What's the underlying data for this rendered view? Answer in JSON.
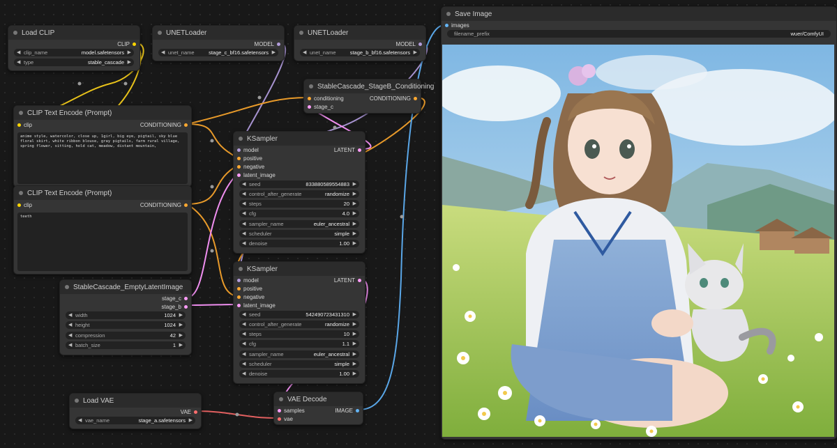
{
  "colors": {
    "clip": "#ffd500",
    "model": "#b39ddb",
    "conditioning": "#ffa931",
    "latent": "#ff9cf9",
    "vae": "#ff6e6e",
    "image": "#64b5f6"
  },
  "load_clip": {
    "title": "Load CLIP",
    "output": "CLIP",
    "clip_name": {
      "label": "clip_name",
      "value": "model.safetensors"
    },
    "type": {
      "label": "type",
      "value": "stable_cascade"
    }
  },
  "unet_c": {
    "title": "UNETLoader",
    "output": "MODEL",
    "unet_name": {
      "label": "unet_name",
      "value": "stage_c_bf16.safetensors"
    }
  },
  "unet_b": {
    "title": "UNETLoader",
    "output": "MODEL",
    "unet_name": {
      "label": "unet_name",
      "value": "stage_b_bf16.safetensors"
    }
  },
  "stageb_cond": {
    "title": "StableCascade_StageB_Conditioning",
    "in1": "conditioning",
    "in2": "stage_c",
    "output": "CONDITIONING"
  },
  "clip_pos": {
    "title": "CLIP Text Encode (Prompt)",
    "input": "clip",
    "output": "CONDITIONING",
    "text": "anime style, watercolor, close up, 1girl, big eye, pigtail, sky blue floral skirt, white ribbon blouse, gray pigtails, farm rural village, spring flower, sitting, hold cat, meadow, distant mountain,"
  },
  "clip_neg": {
    "title": "CLIP Text Encode (Prompt)",
    "input": "clip",
    "output": "CONDITIONING",
    "text": "teeth"
  },
  "ksampler1": {
    "title": "KSampler",
    "inputs": [
      "model",
      "positive",
      "negative",
      "latent_image"
    ],
    "output": "LATENT",
    "widgets": [
      {
        "label": "seed",
        "value": "833880589554883"
      },
      {
        "label": "control_after_generate",
        "value": "randomize"
      },
      {
        "label": "steps",
        "value": "20"
      },
      {
        "label": "cfg",
        "value": "4.0"
      },
      {
        "label": "sampler_name",
        "value": "euler_ancestral"
      },
      {
        "label": "scheduler",
        "value": "simple"
      },
      {
        "label": "denoise",
        "value": "1.00"
      }
    ]
  },
  "ksampler2": {
    "title": "KSampler",
    "inputs": [
      "model",
      "positive",
      "negative",
      "latent_image"
    ],
    "output": "LATENT",
    "widgets": [
      {
        "label": "seed",
        "value": "542490723431310"
      },
      {
        "label": "control_after_generate",
        "value": "randomize"
      },
      {
        "label": "steps",
        "value": "10"
      },
      {
        "label": "cfg",
        "value": "1.1"
      },
      {
        "label": "sampler_name",
        "value": "euler_ancestral"
      },
      {
        "label": "scheduler",
        "value": "simple"
      },
      {
        "label": "denoise",
        "value": "1.00"
      }
    ]
  },
  "empty_latent": {
    "title": "StableCascade_EmptyLatentImage",
    "out1": "stage_c",
    "out2": "stage_b",
    "widgets": [
      {
        "label": "width",
        "value": "1024"
      },
      {
        "label": "height",
        "value": "1024"
      },
      {
        "label": "compression",
        "value": "42"
      },
      {
        "label": "batch_size",
        "value": "1"
      }
    ]
  },
  "load_vae": {
    "title": "Load VAE",
    "output": "VAE",
    "vae_name": {
      "label": "vae_name",
      "value": "stage_a.safetensors"
    }
  },
  "vae_decode": {
    "title": "VAE Decode",
    "in1": "samples",
    "in2": "vae",
    "output": "IMAGE"
  },
  "save_image": {
    "title": "Save Image",
    "input": "images",
    "filename_prefix": {
      "label": "filename_prefix",
      "value": "wuer/ComfyUI"
    }
  }
}
